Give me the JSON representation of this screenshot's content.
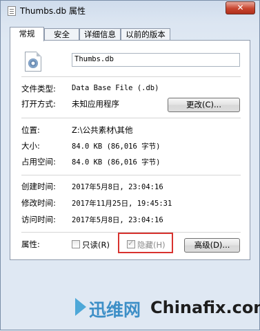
{
  "window": {
    "title": "Thumbs.db 属性",
    "close_glyph": "✕"
  },
  "tabs": [
    {
      "label": "常规",
      "active": true
    },
    {
      "label": "安全",
      "active": false
    },
    {
      "label": "详细信息",
      "active": false
    },
    {
      "label": "以前的版本",
      "active": false
    }
  ],
  "general": {
    "file_name": "Thumbs.db",
    "file_type_label": "文件类型:",
    "file_type_value": "Data Base File (.db)",
    "open_with_label": "打开方式:",
    "open_with_value": "未知应用程序",
    "change_button": "更改(C)...",
    "location_label": "位置:",
    "location_value": "Z:\\公共素材\\其他",
    "size_label": "大小:",
    "size_value": "84.0 KB (86,016 字节)",
    "size_on_disk_label": "占用空间:",
    "size_on_disk_value": "84.0 KB (86,016 字节)",
    "created_label": "创建时间:",
    "created_value": "2017年5月8日, 23:04:16",
    "modified_label": "修改时间:",
    "modified_value": "2017年11月25日, 19:45:31",
    "accessed_label": "访问时间:",
    "accessed_value": "2017年5月8日, 23:04:16",
    "attributes_label": "属性:",
    "readonly_label": "只读(R)",
    "readonly_checked": false,
    "hidden_label": "隐藏(H)",
    "hidden_checked": true,
    "advanced_button": "高级(D)..."
  },
  "watermark": {
    "cn_text": "迅维网",
    "en_text": "Chinafix.com"
  },
  "colors": {
    "highlight_box": "#d8322e",
    "brand_blue": "#3d8fc7"
  }
}
